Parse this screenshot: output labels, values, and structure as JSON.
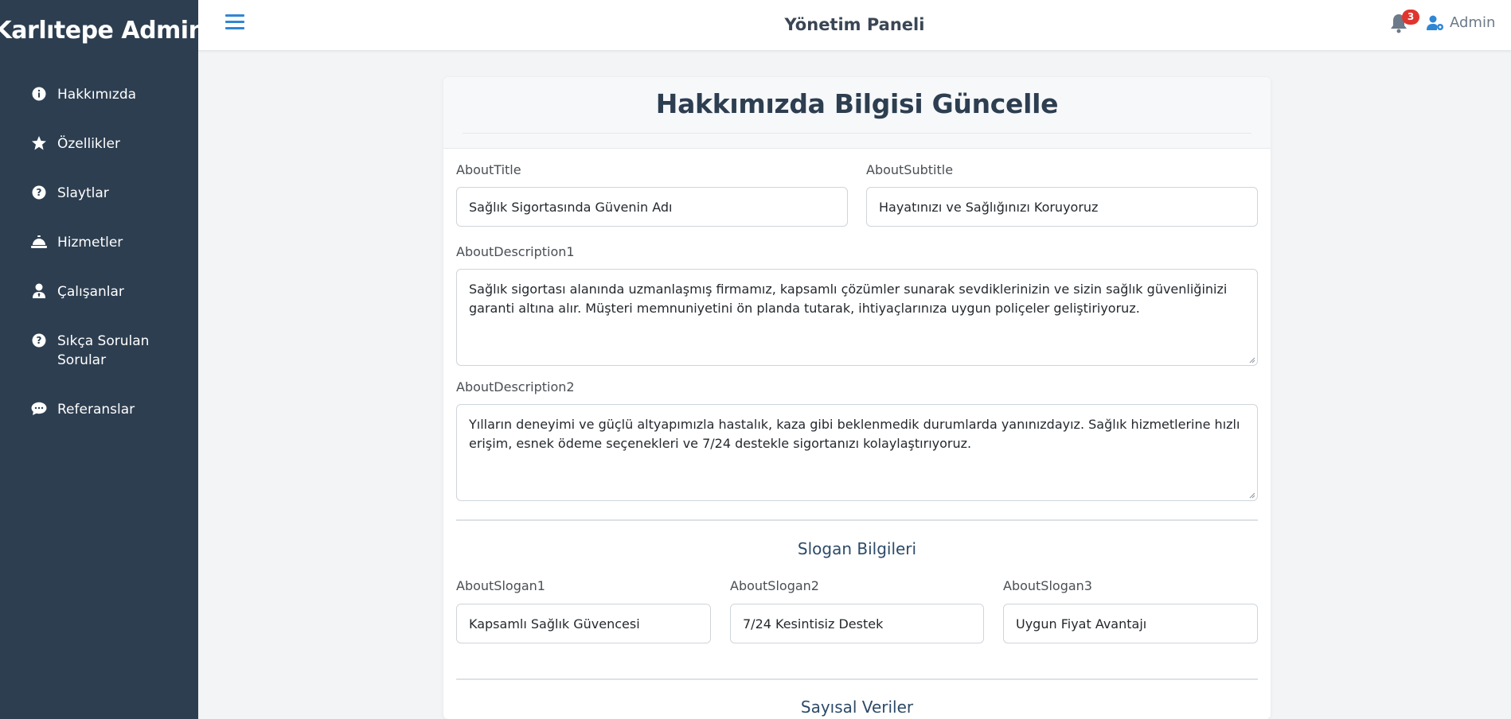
{
  "sidebar": {
    "brand": "Karlıtepe Admin",
    "items": [
      {
        "label": "Hakkımızda",
        "icon": "info-icon"
      },
      {
        "label": "Özellikler",
        "icon": "star-icon"
      },
      {
        "label": "Slaytlar",
        "icon": "question-icon"
      },
      {
        "label": "Hizmetler",
        "icon": "concierge-bell-icon"
      },
      {
        "label": "Çalışanlar",
        "icon": "user-tie-icon"
      },
      {
        "label": "Sıkça Sorulan Sorular",
        "icon": "question-icon"
      },
      {
        "label": "Referanslar",
        "icon": "comment-dots-icon"
      }
    ]
  },
  "header": {
    "title": "Yönetim Paneli",
    "notification_count": "3",
    "user_name": "Admin"
  },
  "form": {
    "title": "Hakkımızda Bilgisi Güncelle",
    "about_title": {
      "label": "AboutTitle",
      "value": "Sağlık Sigortasında Güvenin Adı"
    },
    "about_subtitle": {
      "label": "AboutSubtitle",
      "value": "Hayatınızı ve Sağlığınızı Koruyoruz"
    },
    "about_description1": {
      "label": "AboutDescription1",
      "value": "Sağlık sigortası alanında uzmanlaşmış firmamız, kapsamlı çözümler sunarak sevdiklerinizin ve sizin sağlık güvenliğinizi garanti altına alır. Müşteri memnuniyetini ön planda tutarak, ihtiyaçlarınıza uygun poliçeler geliştiriyoruz."
    },
    "about_description2": {
      "label": "AboutDescription2",
      "value": "Yılların deneyimi ve güçlü altyapımızla hastalık, kaza gibi beklenmedik durumlarda yanınızdayız. Sağlık hizmetlerine hızlı erişim, esnek ödeme seçenekleri ve 7/24 destekle sigortanızı kolaylaştırıyoruz."
    },
    "slogan_section_title": "Slogan Bilgileri",
    "slogan1": {
      "label": "AboutSlogan1",
      "value": "Kapsamlı Sağlık Güvencesi"
    },
    "slogan2": {
      "label": "AboutSlogan2",
      "value": "7/24 Kesintisiz Destek"
    },
    "slogan3": {
      "label": "AboutSlogan3",
      "value": "Uygun Fiyat Avantajı"
    },
    "numeric_section_title": "Sayısal Veriler"
  },
  "colors": {
    "sidebar_bg": "#2d3e50",
    "accent": "#2f86d4",
    "badge": "#e0352e"
  }
}
